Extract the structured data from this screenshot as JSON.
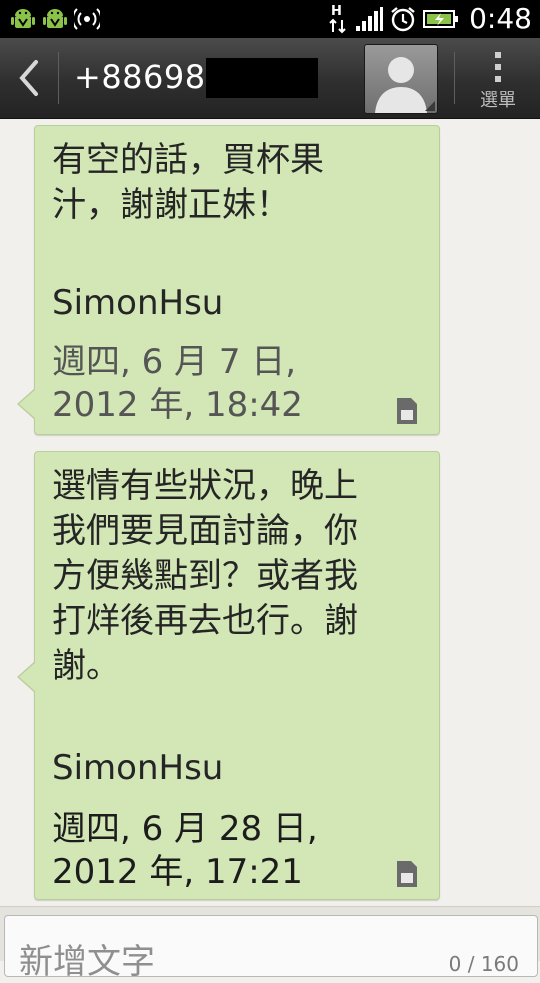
{
  "status_bar": {
    "time": "0:48",
    "icons": [
      "android-debug-icon",
      "android-debug-icon",
      "wifi-hotspot-icon",
      "hspa-data-icon",
      "signal-bars-icon",
      "alarm-clock-icon",
      "battery-charging-icon"
    ],
    "network_label": "H"
  },
  "header": {
    "phone_number": "+886988",
    "menu_label": "選單"
  },
  "messages": [
    {
      "body": "有空的話，買杯果\n汁，謝謝正妹！",
      "signature": "SimonHsu",
      "timestamp": "週四, 6 月 7 日, 2012\n年, 18:42",
      "storage_icon": "sim-card-icon"
    },
    {
      "body": "選情有些狀況，晚上\n我們要見面討論，你\n方便幾點到？或者我\n打烊後再去也行。謝\n謝。",
      "signature": "SimonHsu",
      "timestamp": "週四, 6 月 28 日,\n2012 年, 17:21",
      "storage_icon": "sim-card-icon"
    }
  ],
  "compose": {
    "placeholder": "新增文字",
    "char_count": "0 / 160"
  },
  "colors": {
    "bubble": "#d2e6b6",
    "titlebar": "#333333",
    "background": "#f1f0ec"
  }
}
